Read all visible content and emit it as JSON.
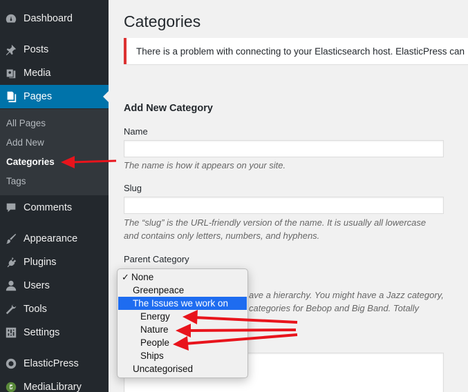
{
  "sidebar": {
    "items": [
      {
        "label": "Dashboard",
        "icon": "dashboard-icon"
      },
      {
        "label": "Posts",
        "icon": "pin-icon"
      },
      {
        "label": "Media",
        "icon": "media-icon"
      },
      {
        "label": "Pages",
        "icon": "pages-icon"
      },
      {
        "label": "Comments",
        "icon": "comment-icon"
      },
      {
        "label": "Appearance",
        "icon": "brush-icon"
      },
      {
        "label": "Plugins",
        "icon": "plugin-icon"
      },
      {
        "label": "Users",
        "icon": "user-icon"
      },
      {
        "label": "Tools",
        "icon": "wrench-icon"
      },
      {
        "label": "Settings",
        "icon": "settings-icon"
      },
      {
        "label": "ElasticPress",
        "icon": "elasticpress-icon"
      },
      {
        "label": "MediaLibrary",
        "icon": "medialibrary-icon"
      }
    ],
    "submenu": [
      "All Pages",
      "Add New",
      "Categories",
      "Tags"
    ]
  },
  "main": {
    "title": "Categories",
    "notice": "There is a problem with connecting to your Elasticsearch host. ElasticPress can",
    "form_title": "Add New Category",
    "name_label": "Name",
    "name_desc": "The name is how it appears on your site.",
    "slug_label": "Slug",
    "slug_desc_1": "The “slug” is the URL-friendly version of the name. It is usually all lowercase",
    "slug_desc_2": "and contains only letters, numbers, and hyphens.",
    "parent_label": "Parent Category",
    "parent_desc_1": "ave a hierarchy. You might have a Jazz category,",
    "parent_desc_2": "categories for Bebop and Big Band. Totally"
  },
  "dropdown": {
    "options": [
      "None",
      "Greenpeace",
      "The Issues we work on",
      "Energy",
      "Nature",
      "People",
      "Ships",
      "Uncategorised"
    ],
    "checkmark": "✓"
  },
  "colors": {
    "sidebar_bg": "#23282d",
    "submenu_bg": "#32373c",
    "active": "#0073aa",
    "notice_border": "#dc3232",
    "selected_option": "#1e6cf0",
    "annotation_arrow": "#e8141c"
  }
}
